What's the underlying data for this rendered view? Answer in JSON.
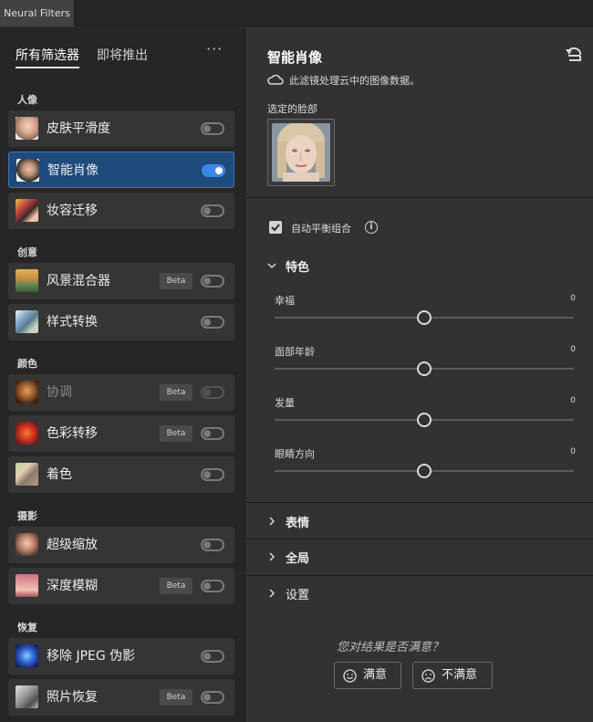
{
  "window": {
    "tab_title": "Neural Filters"
  },
  "left": {
    "tabs": [
      {
        "label": "所有筛选器",
        "active": true
      },
      {
        "label": "即将推出",
        "active": false
      }
    ],
    "more": "···",
    "categories": [
      {
        "label": "人像",
        "items": [
          {
            "name": "皮肤平滑度",
            "badge": "",
            "enabled": false,
            "selected": false,
            "dim": false
          },
          {
            "name": "智能肖像",
            "badge": "",
            "enabled": true,
            "selected": true,
            "dim": false
          },
          {
            "name": "妆容迁移",
            "badge": "",
            "enabled": false,
            "selected": false,
            "dim": false
          }
        ]
      },
      {
        "label": "创意",
        "items": [
          {
            "name": "风景混合器",
            "badge": "Beta",
            "enabled": false,
            "selected": false,
            "dim": false
          },
          {
            "name": "样式转换",
            "badge": "",
            "enabled": false,
            "selected": false,
            "dim": false
          }
        ]
      },
      {
        "label": "颜色",
        "items": [
          {
            "name": "协调",
            "badge": "Beta",
            "enabled": false,
            "selected": false,
            "dim": true
          },
          {
            "name": "色彩转移",
            "badge": "Beta",
            "enabled": false,
            "selected": false,
            "dim": false
          },
          {
            "name": "着色",
            "badge": "",
            "enabled": false,
            "selected": false,
            "dim": false
          }
        ]
      },
      {
        "label": "摄影",
        "items": [
          {
            "name": "超级缩放",
            "badge": "",
            "enabled": false,
            "selected": false,
            "dim": false
          },
          {
            "name": "深度模糊",
            "badge": "Beta",
            "enabled": false,
            "selected": false,
            "dim": false
          }
        ]
      },
      {
        "label": "恢复",
        "items": [
          {
            "name": "移除 JPEG 伪影",
            "badge": "",
            "enabled": false,
            "selected": false,
            "dim": false
          },
          {
            "name": "照片恢复",
            "badge": "Beta",
            "enabled": false,
            "selected": false,
            "dim": false
          }
        ]
      }
    ]
  },
  "right": {
    "title": "智能肖像",
    "cloud_note": "此滤镜处理云中的图像数据。",
    "selected_face_label": "选定的脸部",
    "auto_balance": {
      "label": "自动平衡组合",
      "checked": true
    },
    "features": {
      "label": "特色",
      "expanded": true,
      "sliders": [
        {
          "label": "幸福",
          "value": "0",
          "fraction": 0.5
        },
        {
          "label": "面部年龄",
          "value": "0",
          "fraction": 0.5
        },
        {
          "label": "发量",
          "value": "0",
          "fraction": 0.5
        },
        {
          "label": "眼睛方向",
          "value": "0",
          "fraction": 0.5
        }
      ]
    },
    "sections": [
      {
        "label": "表情"
      },
      {
        "label": "全局"
      },
      {
        "label": "设置"
      }
    ],
    "feedback": {
      "question": "您对结果是否满意？",
      "yes": "满意",
      "no": "不满意"
    }
  }
}
